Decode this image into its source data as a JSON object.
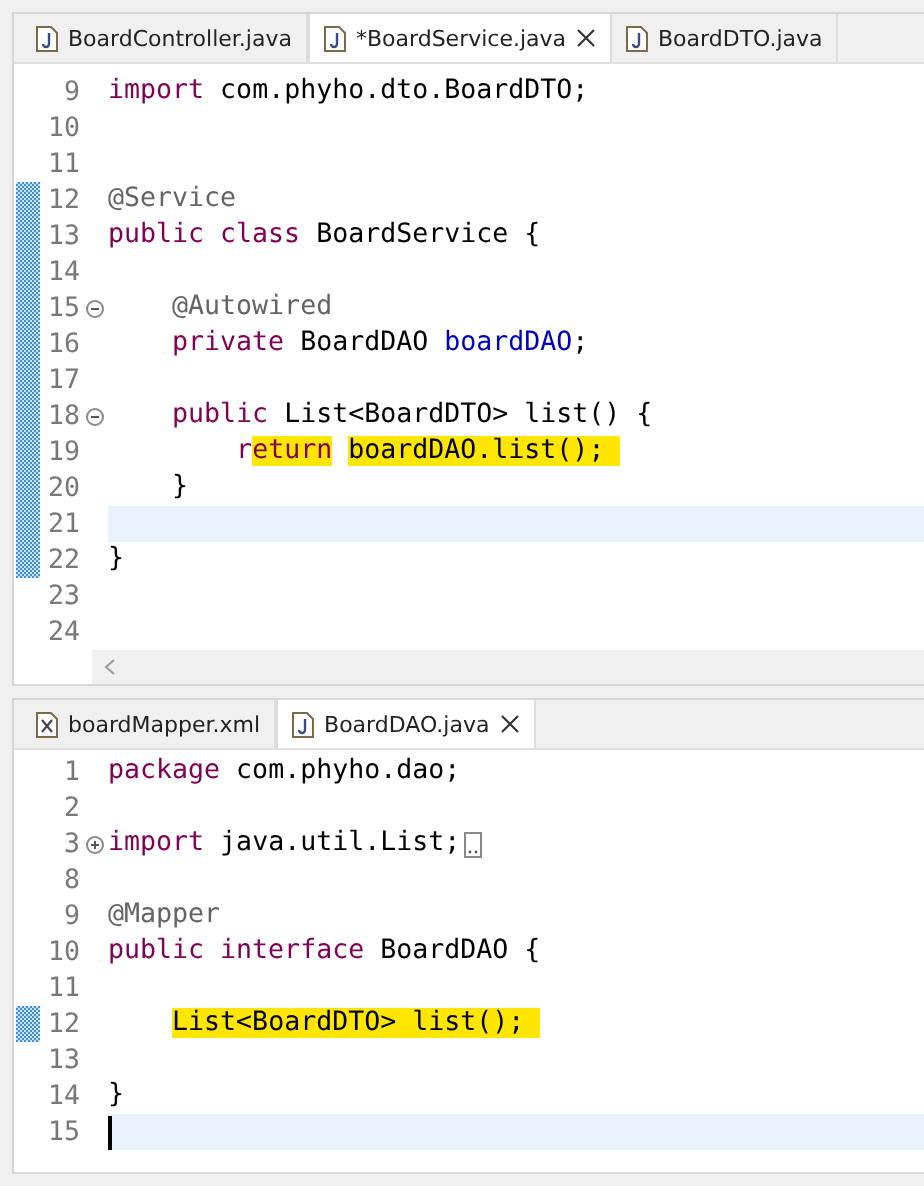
{
  "editors": [
    {
      "tabs": [
        {
          "label": "BoardController.java",
          "kind": "java",
          "selected": false
        },
        {
          "label": "*BoardService.java",
          "kind": "java",
          "selected": true
        },
        {
          "label": "BoardDTO.java",
          "kind": "java",
          "selected": false
        }
      ],
      "h_scrollbar": true,
      "lines": [
        {
          "number": "9",
          "tokens": [
            {
              "text": "import",
              "kind": "keyword"
            },
            {
              "text": " com.phyho.dto.BoardDTO;",
              "kind": "plain"
            }
          ]
        },
        {
          "number": "10"
        },
        {
          "number": "11"
        },
        {
          "number": "12",
          "changed": true,
          "tokens": [
            {
              "text": "@Service",
              "kind": "annotation"
            }
          ]
        },
        {
          "number": "13",
          "changed": true,
          "tokens": [
            {
              "text": "public class",
              "kind": "keyword"
            },
            {
              "text": " BoardService {",
              "kind": "plain"
            }
          ]
        },
        {
          "number": "14",
          "changed": true
        },
        {
          "number": "15",
          "changed": true,
          "collapsed": false,
          "tokens": [
            {
              "text": "    @Autowired",
              "kind": "annotation"
            }
          ]
        },
        {
          "number": "16",
          "changed": true,
          "tokens": [
            {
              "text": "    private",
              "kind": "keyword"
            },
            {
              "text": " BoardDAO ",
              "kind": "plain"
            },
            {
              "text": "boardDAO",
              "kind": "field"
            },
            {
              "text": ";",
              "kind": "plain"
            }
          ]
        },
        {
          "number": "17",
          "changed": true
        },
        {
          "number": "18",
          "changed": true,
          "collapsed": false,
          "tokens": [
            {
              "text": "    public",
              "kind": "keyword"
            },
            {
              "text": " List<BoardDTO> list() {",
              "kind": "plain"
            }
          ]
        },
        {
          "number": "19",
          "changed": true,
          "tokens": [
            {
              "text": "        r",
              "kind": "keyword"
            },
            {
              "text": "eturn",
              "kind": "keyword",
              "highlight": true
            },
            {
              "text": " boardDAO.list(); ",
              "kind": "plain",
              "highlight": true
            }
          ]
        },
        {
          "number": "20",
          "changed": true,
          "tokens": [
            {
              "text": "    }",
              "kind": "plain"
            }
          ]
        },
        {
          "number": "21",
          "changed": true,
          "current": true
        },
        {
          "number": "22",
          "changed": true,
          "tokens": [
            {
              "text": "}",
              "kind": "plain"
            }
          ]
        },
        {
          "number": "23"
        },
        {
          "number": "24"
        }
      ]
    },
    {
      "tabs": [
        {
          "label": "boardMapper.xml",
          "kind": "xml",
          "selected": false
        },
        {
          "label": "BoardDAO.java",
          "kind": "java",
          "selected": true
        }
      ],
      "lines": [
        {
          "number": "1",
          "tokens": [
            {
              "text": "package",
              "kind": "keyword"
            },
            {
              "text": " com.phyho.dao;",
              "kind": "plain"
            }
          ]
        },
        {
          "number": "2"
        },
        {
          "number": "3",
          "collapsed": true,
          "tokens": [
            {
              "text": "import",
              "kind": "keyword"
            },
            {
              "text": " java.util.List;",
              "kind": "plain"
            }
          ]
        },
        {
          "number": "8"
        },
        {
          "number": "9",
          "tokens": [
            {
              "text": "@Mapper",
              "kind": "annotation"
            }
          ]
        },
        {
          "number": "10",
          "tokens": [
            {
              "text": "public interface",
              "kind": "keyword"
            },
            {
              "text": " BoardDAO {",
              "kind": "plain"
            }
          ]
        },
        {
          "number": "11"
        },
        {
          "number": "12",
          "changed": true,
          "tokens": [
            {
              "text": "    List<BoardDTO> list(); ",
              "kind": "plain",
              "highlight": true
            }
          ]
        },
        {
          "number": "13"
        },
        {
          "number": "14",
          "tokens": [
            {
              "text": "}",
              "kind": "plain"
            }
          ]
        },
        {
          "number": "15",
          "current": true,
          "cursor": true
        }
      ]
    }
  ]
}
